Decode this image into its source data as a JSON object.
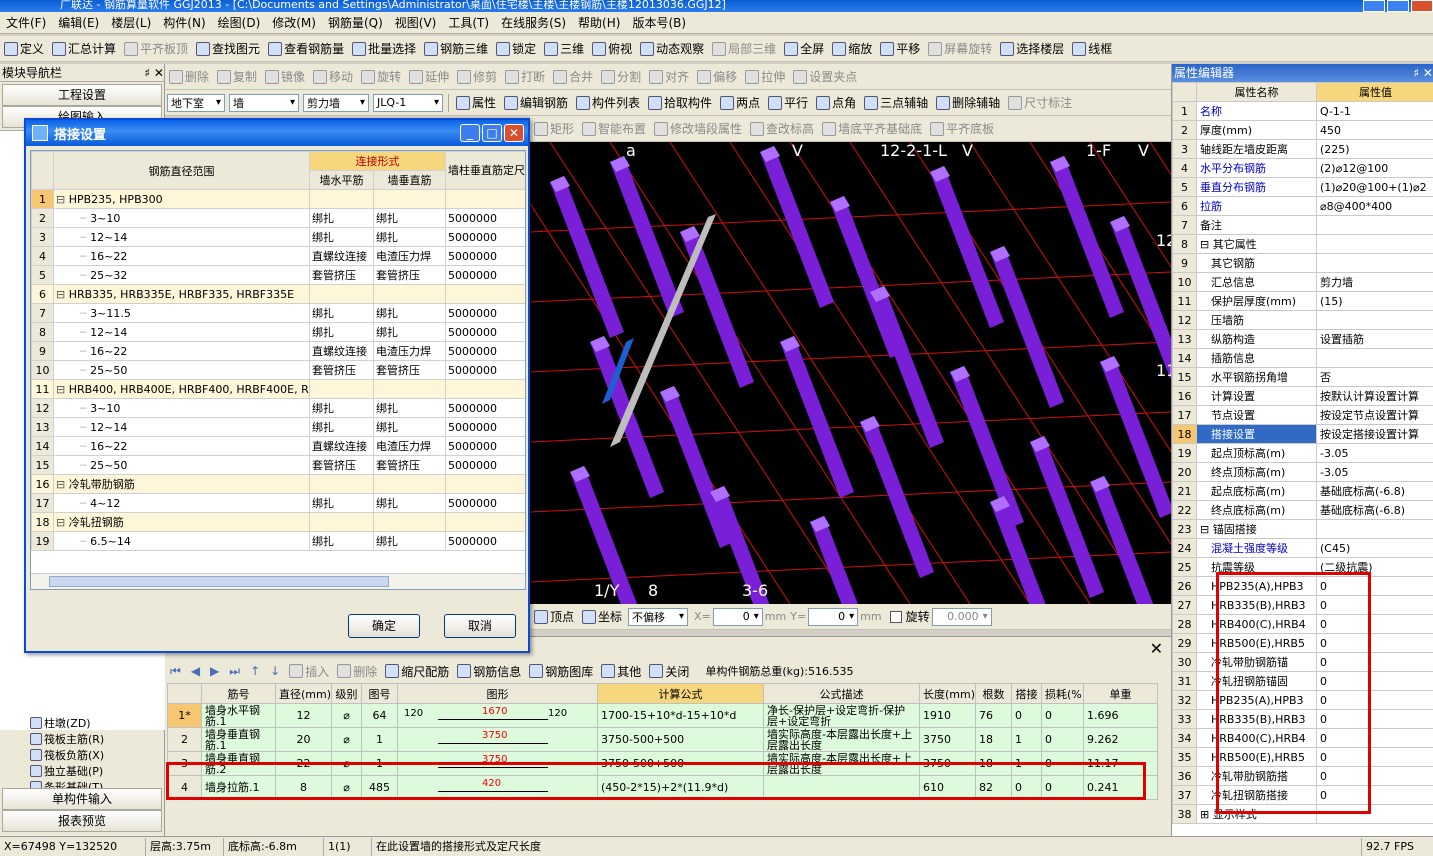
{
  "window": {
    "title": "广联达 - 钢筋算量软件 GGJ2013 - [C:\\Documents and Settings\\Administrator\\桌面\\住宅楼\\主楼\\主楼钢筋\\主楼12013036.GGJ12]"
  },
  "menu": [
    "文件(F)",
    "编辑(E)",
    "楼层(L)",
    "构件(N)",
    "绘图(D)",
    "修改(M)",
    "钢筋量(Q)",
    "视图(V)",
    "工具(T)",
    "在线服务(S)",
    "帮助(H)",
    "版本号(B)"
  ],
  "toolbar1": [
    "定义",
    "汇总计算",
    "平齐板顶",
    "查找图元",
    "查看钢筋量",
    "批量选择",
    "钢筋三维",
    "锁定",
    "三维",
    "俯视",
    "动态观察",
    "局部三维",
    "全屏",
    "缩放",
    "平移",
    "屏幕旋转",
    "选择楼层",
    "线框"
  ],
  "toolbar2": [
    "删除",
    "复制",
    "镜像",
    "移动",
    "旋转",
    "延伸",
    "修剪",
    "打断",
    "合并",
    "分割",
    "对齐",
    "偏移",
    "拉伸",
    "设置夹点"
  ],
  "toolbar3": {
    "floor": "地下室",
    "type": "墙",
    "subtype": "剪力墙",
    "name": "JLQ-1",
    "buttons": [
      "属性",
      "编辑钢筋",
      "构件列表",
      "拾取构件",
      "两点",
      "平行",
      "点角",
      "三点辅轴",
      "删除辅轴",
      "尺寸标注"
    ]
  },
  "toolbar4": [
    "矩形",
    "智能布置",
    "修改墙段属性",
    "查改标高",
    "墙底平齐基础底",
    "平齐底板"
  ],
  "left_panel": {
    "title": "模块导航栏",
    "setup_btn": "工程设置",
    "draw_btn": "绘图输入",
    "tree": [
      "柱墩(ZD)",
      "筏板主筋(R)",
      "筏板负筋(X)",
      "独立基础(P)",
      "条形基础(T)",
      "桩承台(V)",
      "承台梁(V)"
    ],
    "single_input": "单构件输入",
    "report": "报表预览"
  },
  "dialog": {
    "title": "搭接设置",
    "headers": {
      "range": "钢筋直径范围",
      "conn": "连接形式",
      "h": "墙水平筋",
      "v": "墙垂直筋",
      "fix": "墙柱垂直筋定尺"
    },
    "rows": [
      {
        "n": "1",
        "grp": true,
        "name": "HPB235, HPB300"
      },
      {
        "n": "2",
        "name": "3~10",
        "h": "绑扎",
        "v": "绑扎",
        "fix": "5000000"
      },
      {
        "n": "3",
        "name": "12~14",
        "h": "绑扎",
        "v": "绑扎",
        "fix": "5000000"
      },
      {
        "n": "4",
        "name": "16~22",
        "h": "直螺纹连接",
        "v": "电渣压力焊",
        "fix": "5000000"
      },
      {
        "n": "5",
        "name": "25~32",
        "h": "套管挤压",
        "v": "套管挤压",
        "fix": "5000000"
      },
      {
        "n": "6",
        "grp": true,
        "name": "HRB335, HRB335E, HRBF335, HRBF335E"
      },
      {
        "n": "7",
        "name": "3~11.5",
        "h": "绑扎",
        "v": "绑扎",
        "fix": "5000000"
      },
      {
        "n": "8",
        "name": "12~14",
        "h": "绑扎",
        "v": "绑扎",
        "fix": "5000000"
      },
      {
        "n": "9",
        "name": "16~22",
        "h": "直螺纹连接",
        "v": "电渣压力焊",
        "fix": "5000000"
      },
      {
        "n": "10",
        "name": "25~50",
        "h": "套管挤压",
        "v": "套管挤压",
        "fix": "5000000"
      },
      {
        "n": "11",
        "grp": true,
        "name": "HRB400, HRB400E, HRBF400, HRBF400E, RRB400,"
      },
      {
        "n": "12",
        "name": "3~10",
        "h": "绑扎",
        "v": "绑扎",
        "fix": "5000000"
      },
      {
        "n": "13",
        "name": "12~14",
        "h": "绑扎",
        "v": "绑扎",
        "fix": "5000000"
      },
      {
        "n": "14",
        "name": "16~22",
        "h": "直螺纹连接",
        "v": "电渣压力焊",
        "fix": "5000000"
      },
      {
        "n": "15",
        "name": "25~50",
        "h": "套管挤压",
        "v": "套管挤压",
        "fix": "5000000"
      },
      {
        "n": "16",
        "grp": true,
        "name": "冷轧带肋钢筋"
      },
      {
        "n": "17",
        "name": "4~12",
        "h": "绑扎",
        "v": "绑扎",
        "fix": "5000000"
      },
      {
        "n": "18",
        "grp": true,
        "name": "冷轧扭钢筋"
      },
      {
        "n": "19",
        "name": "6.5~14",
        "h": "绑扎",
        "v": "绑扎",
        "fix": "5000000"
      }
    ],
    "ok": "确定",
    "cancel": "取消"
  },
  "viewport": {
    "labels": [
      "a",
      "V",
      "12-2-1-L",
      "V",
      "1-F",
      "V",
      "12",
      "11",
      "1/Y",
      "8",
      "3-6"
    ]
  },
  "viewbar": {
    "point": "顶点",
    "coord": "坐标",
    "offset": "不偏移",
    "x": "0",
    "y": "0",
    "mm": "mm",
    "rotate": "旋转",
    "angle": "0.000"
  },
  "property_editor": {
    "title": "属性编辑器",
    "col_name": "属性名称",
    "col_value": "属性值",
    "rows": [
      {
        "n": "1",
        "k": "名称",
        "v": "Q-1-1",
        "blue": true
      },
      {
        "n": "2",
        "k": "厚度(mm)",
        "v": "450"
      },
      {
        "n": "3",
        "k": "轴线距左墙皮距离",
        "v": "(225)"
      },
      {
        "n": "4",
        "k": "水平分布钢筋",
        "v": "(2)⌀12@100",
        "blue": true
      },
      {
        "n": "5",
        "k": "垂直分布钢筋",
        "v": "(1)⌀20@100+(1)⌀2",
        "blue": true
      },
      {
        "n": "6",
        "k": "拉筋",
        "v": "⌀8@400*400",
        "blue": true
      },
      {
        "n": "7",
        "k": "备注",
        "v": ""
      },
      {
        "n": "8",
        "k": "⊟ 其它属性",
        "v": ""
      },
      {
        "n": "9",
        "k": "其它钢筋",
        "v": "",
        "i": true
      },
      {
        "n": "10",
        "k": "汇总信息",
        "v": "剪力墙",
        "i": true
      },
      {
        "n": "11",
        "k": "保护层厚度(mm)",
        "v": "(15)",
        "i": true
      },
      {
        "n": "12",
        "k": "压墙筋",
        "v": "",
        "i": true
      },
      {
        "n": "13",
        "k": "纵筋构造",
        "v": "设置插筋",
        "i": true
      },
      {
        "n": "14",
        "k": "插筋信息",
        "v": "",
        "i": true
      },
      {
        "n": "15",
        "k": "水平钢筋拐角增",
        "v": "否",
        "i": true
      },
      {
        "n": "16",
        "k": "计算设置",
        "v": "按默认计算设置计算",
        "i": true
      },
      {
        "n": "17",
        "k": "节点设置",
        "v": "按设定节点设置计算",
        "i": true
      },
      {
        "n": "18",
        "k": "搭接设置",
        "v": "按设定搭接设置计算",
        "i": true,
        "sel": true
      },
      {
        "n": "19",
        "k": "起点顶标高(m)",
        "v": "-3.05",
        "i": true
      },
      {
        "n": "20",
        "k": "终点顶标高(m)",
        "v": "-3.05",
        "i": true
      },
      {
        "n": "21",
        "k": "起点底标高(m)",
        "v": "基础底标高(-6.8)",
        "i": true
      },
      {
        "n": "22",
        "k": "终点底标高(m)",
        "v": "基础底标高(-6.8)",
        "i": true
      },
      {
        "n": "23",
        "k": "⊟ 锚固搭接",
        "v": ""
      },
      {
        "n": "24",
        "k": "混凝土强度等级",
        "v": "(C45)",
        "i": true,
        "blue": true
      },
      {
        "n": "25",
        "k": "抗震等级",
        "v": "(二级抗震)",
        "i": true
      },
      {
        "n": "26",
        "k": "HPB235(A),HPB3",
        "v": "0",
        "i": true
      },
      {
        "n": "27",
        "k": "HRB335(B),HRB3",
        "v": "0",
        "i": true
      },
      {
        "n": "28",
        "k": "HRB400(C),HRB4",
        "v": "0",
        "i": true
      },
      {
        "n": "29",
        "k": "HRB500(E),HRB5",
        "v": "0",
        "i": true
      },
      {
        "n": "30",
        "k": "冷轧带肋钢筋锚",
        "v": "0",
        "i": true
      },
      {
        "n": "31",
        "k": "冷轧扭钢筋锚固",
        "v": "0",
        "i": true
      },
      {
        "n": "32",
        "k": "HPB235(A),HPB3",
        "v": "0",
        "i": true
      },
      {
        "n": "33",
        "k": "HRB335(B),HRB3",
        "v": "0",
        "i": true
      },
      {
        "n": "34",
        "k": "HRB400(C),HRB4",
        "v": "0",
        "i": true
      },
      {
        "n": "35",
        "k": "HRB500(E),HRB5",
        "v": "0",
        "i": true
      },
      {
        "n": "36",
        "k": "冷轧带肋钢筋搭",
        "v": "0",
        "i": true
      },
      {
        "n": "37",
        "k": "冷轧扭钢筋搭接",
        "v": "0",
        "i": true
      },
      {
        "n": "38",
        "k": "⊞ 显示样式",
        "v": ""
      }
    ]
  },
  "bottom": {
    "toolbar": [
      "插入",
      "删除",
      "缩尺配筋",
      "钢筋信息",
      "钢筋图库",
      "其他",
      "关闭"
    ],
    "total": "单构件钢筋总重(kg):516.535",
    "headers": [
      "筋号",
      "直径(mm)",
      "级别",
      "图号",
      "图形",
      "计算公式",
      "公式描述",
      "长度(mm)",
      "根数",
      "搭接",
      "损耗(%)",
      "单重"
    ],
    "rows": [
      {
        "n": "1*",
        "name": "墙身水平钢筋.1",
        "d": "12",
        "lvl": "⌀",
        "fig": "64",
        "shape_l": "120",
        "shape_m": "1670",
        "shape_r": "120",
        "formula": "1700-15+10*d-15+10*d",
        "desc": "净长-保护层+设定弯折-保护层+设定弯折",
        "len": "1910",
        "cnt": "76",
        "lap": "0",
        "loss": "0",
        "w": "1.696"
      },
      {
        "n": "2",
        "name": "墙身垂直钢筋.1",
        "d": "20",
        "lvl": "⌀",
        "fig": "1",
        "shape_l": "",
        "shape_m": "3750",
        "shape_r": "",
        "formula": "3750-500+500",
        "desc": "墙实际高度-本层露出长度+上层露出长度",
        "len": "3750",
        "cnt": "18",
        "lap": "1",
        "loss": "0",
        "w": "9.262"
      },
      {
        "n": "3",
        "name": "墙身垂直钢筋.2",
        "d": "22",
        "lvl": "⌀",
        "fig": "1",
        "shape_l": "",
        "shape_m": "3750",
        "shape_r": "",
        "formula": "3750-500+500",
        "desc": "墙实际高度-本层露出长度+上层露出长度",
        "len": "3750",
        "cnt": "18",
        "lap": "1",
        "loss": "0",
        "w": "11.17"
      },
      {
        "n": "4",
        "name": "墙身拉筋.1",
        "d": "8",
        "lvl": "⌀",
        "fig": "485",
        "shape_l": "",
        "shape_m": "420",
        "shape_r": "",
        "formula": "(450-2*15)+2*(11.9*d)",
        "desc": "",
        "len": "610",
        "cnt": "82",
        "lap": "0",
        "loss": "0",
        "w": "0.241"
      }
    ]
  },
  "status": {
    "coords": "X=67498 Y=132520",
    "floor_h": "层高:3.75m",
    "base_h": "底标高:-6.8m",
    "count": "1(1)",
    "hint": "在此设置墙的搭接形式及定尺长度",
    "fps": "92.7 FPS"
  }
}
